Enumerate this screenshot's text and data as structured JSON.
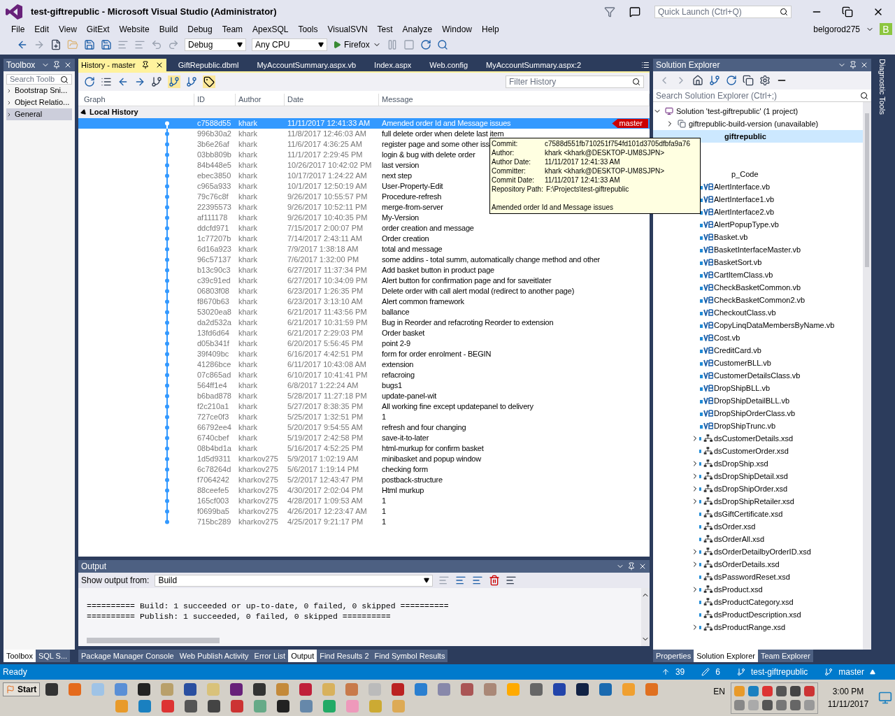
{
  "window": {
    "title": "test-giftrepublic - Microsoft Visual Studio (Administrator)",
    "quick_launch": {
      "placeholder": "Quick Launch (Ctrl+Q)"
    },
    "user": "belgorod275",
    "avatar": "B"
  },
  "menu": [
    "File",
    "Edit",
    "View",
    "GitExt",
    "Website",
    "Build",
    "Debug",
    "Team",
    "ApexSQL",
    "Tools",
    "VisualSVN",
    "Test",
    "Analyze",
    "Window",
    "Help"
  ],
  "toolbar": {
    "configuration": "Debug",
    "platform": "Any CPU",
    "run": "Firefox"
  },
  "toolbox": {
    "title": "Toolbox",
    "search": {
      "placeholder": "Search Toolb"
    },
    "items": [
      {
        "label": "Bootstrap Sni...",
        "selected": false
      },
      {
        "label": "Object Relatio...",
        "selected": false
      },
      {
        "label": "General",
        "selected": true
      }
    ],
    "tabs": [
      {
        "label": "Toolbox",
        "selected": true
      },
      {
        "label": "SQL S...",
        "selected": false
      }
    ]
  },
  "doc_tabs": [
    {
      "label": "History - master",
      "selected": true
    },
    {
      "label": "GiftRepublic.dbml",
      "selected": false
    },
    {
      "label": "MyAccountSummary.aspx.vb",
      "selected": false
    },
    {
      "label": "Index.aspx",
      "selected": false
    },
    {
      "label": "Web.config",
      "selected": false
    },
    {
      "label": "MyAccountSummary.aspx:2",
      "selected": false
    }
  ],
  "history": {
    "filter": {
      "placeholder": "Filter History"
    },
    "columns": [
      "Graph",
      "ID",
      "Author",
      "Date",
      "Message"
    ],
    "group": "Local History",
    "rows": [
      {
        "id": "c7588d55",
        "author": "khark",
        "date": "11/11/2017 12:41:33 AM",
        "message": "Amended order Id and Message issues",
        "selected": true,
        "branch": "master"
      },
      {
        "id": "996b30a2",
        "author": "khark",
        "date": "11/8/2017 12:46:03 AM",
        "message": "full delete order when delete last item",
        "selected": false
      },
      {
        "id": "3b6e26af",
        "author": "khark",
        "date": "11/6/2017 4:36:25 AM",
        "message": "register page and some other iss",
        "selected": false
      },
      {
        "id": "03bb809b",
        "author": "khark",
        "date": "11/1/2017 2:29:45 PM",
        "message": "login & bug with delete order",
        "selected": false
      },
      {
        "id": "84b448e5",
        "author": "khark",
        "date": "10/26/2017 10:42:02 PM",
        "message": "last version",
        "selected": false
      },
      {
        "id": "ebec3850",
        "author": "khark",
        "date": "10/17/2017 1:24:22 AM",
        "message": "next step",
        "selected": false
      },
      {
        "id": "c965a933",
        "author": "khark",
        "date": "10/1/2017 12:50:19 AM",
        "message": "User-Property-Edit",
        "selected": false
      },
      {
        "id": "79c76c8f",
        "author": "khark",
        "date": "9/26/2017 10:55:57 PM",
        "message": "Procedure-refresh",
        "selected": false
      },
      {
        "id": "22395573",
        "author": "khark",
        "date": "9/26/2017 10:52:11 PM",
        "message": "merge-from-server",
        "selected": false
      },
      {
        "id": "af111178",
        "author": "khark",
        "date": "9/26/2017 10:40:35 PM",
        "message": "My-Version",
        "selected": false
      },
      {
        "id": "ddcfd971",
        "author": "khark",
        "date": "7/15/2017 2:00:07 PM",
        "message": "order creation and message",
        "selected": false
      },
      {
        "id": "1c77207b",
        "author": "khark",
        "date": "7/14/2017 2:43:11 AM",
        "message": "Order creation",
        "selected": false
      },
      {
        "id": "6d16a923",
        "author": "khark",
        "date": "7/9/2017 1:38:18 AM",
        "message": "total and message",
        "selected": false
      },
      {
        "id": "96c57137",
        "author": "khark",
        "date": "7/6/2017 1:32:00 PM",
        "message": "some addins - total summ, automatically change method and other",
        "selected": false
      },
      {
        "id": "b13c90c3",
        "author": "khark",
        "date": "6/27/2017 11:37:34 PM",
        "message": "Add basket button in product page",
        "selected": false
      },
      {
        "id": "c39c91ed",
        "author": "khark",
        "date": "6/27/2017 10:34:09 PM",
        "message": "Alert button for confirmation page and for saveitlater",
        "selected": false
      },
      {
        "id": "06803f08",
        "author": "khark",
        "date": "6/23/2017 1:26:35 PM",
        "message": "Delete order with call alert modal (redirect to another page)",
        "selected": false
      },
      {
        "id": "f8670b63",
        "author": "khark",
        "date": "6/23/2017 3:13:10 AM",
        "message": "Alert common framework",
        "selected": false
      },
      {
        "id": "53020ea8",
        "author": "khark",
        "date": "6/21/2017 11:43:56 PM",
        "message": "ballance",
        "selected": false
      },
      {
        "id": "da2d532a",
        "author": "khark",
        "date": "6/21/2017 10:31:59 PM",
        "message": "Bug in Reorder and refacroting Reorder to extension",
        "selected": false
      },
      {
        "id": "13fd6d64",
        "author": "khark",
        "date": "6/21/2017 2:29:03 PM",
        "message": "Order basket",
        "selected": false
      },
      {
        "id": "d05b341f",
        "author": "khark",
        "date": "6/20/2017 5:56:45 PM",
        "message": "point 2-9",
        "selected": false
      },
      {
        "id": "39f409bc",
        "author": "khark",
        "date": "6/16/2017 4:42:51 PM",
        "message": "form for order enrolment - BEGIN",
        "selected": false
      },
      {
        "id": "41286bce",
        "author": "khark",
        "date": "6/11/2017 10:43:08 AM",
        "message": "extension",
        "selected": false
      },
      {
        "id": "07c865ad",
        "author": "khark",
        "date": "6/10/2017 10:41:41 PM",
        "message": "refacroing",
        "selected": false
      },
      {
        "id": "564ff1e4",
        "author": "khark",
        "date": "6/8/2017 1:22:24 AM",
        "message": "bugs1",
        "selected": false
      },
      {
        "id": "b6bad878",
        "author": "khark",
        "date": "5/28/2017 11:27:18 PM",
        "message": "update-panel-wit",
        "selected": false
      },
      {
        "id": "f2c210a1",
        "author": "khark",
        "date": "5/27/2017 8:38:35 PM",
        "message": "All working fine except updatepanel to delivery",
        "selected": false
      },
      {
        "id": "727ce0f3",
        "author": "khark",
        "date": "5/25/2017 1:32:51 PM",
        "message": "1",
        "selected": false
      },
      {
        "id": "66792ee4",
        "author": "khark",
        "date": "5/20/2017 9:54:55 AM",
        "message": "refresh and four changing",
        "selected": false
      },
      {
        "id": "6740cbef",
        "author": "khark",
        "date": "5/19/2017 2:42:58 PM",
        "message": "save-it-to-later",
        "selected": false
      },
      {
        "id": "08b4bd1a",
        "author": "khark",
        "date": "5/16/2017 4:52:25 PM",
        "message": "html-murkup for confirm basket",
        "selected": false
      },
      {
        "id": "1d5d9311",
        "author": "kharkov275",
        "date": "5/9/2017 1:02:19 AM",
        "message": "minibasket and popup window",
        "selected": false
      },
      {
        "id": "6c78264d",
        "author": "kharkov275",
        "date": "5/6/2017 1:19:14 PM",
        "message": "checking form",
        "selected": false
      },
      {
        "id": "f7064242",
        "author": "kharkov275",
        "date": "5/2/2017 12:43:47 PM",
        "message": "postback-structure",
        "selected": false
      },
      {
        "id": "88ceefe5",
        "author": "kharkov275",
        "date": "4/30/2017 2:02:04 PM",
        "message": "Html murkup",
        "selected": false
      },
      {
        "id": "165cf003",
        "author": "kharkov275",
        "date": "4/28/2017 1:09:53 AM",
        "message": "1",
        "selected": false
      },
      {
        "id": "f0699ba5",
        "author": "kharkov275",
        "date": "4/26/2017 12:23:47 AM",
        "message": "1",
        "selected": false
      },
      {
        "id": "715bc289",
        "author": "kharkov275",
        "date": "4/25/2017 9:21:17 PM",
        "message": "1",
        "selected": false
      }
    ]
  },
  "tooltip": {
    "fields": [
      {
        "label": "Commit:",
        "value": "c7588d551fb710251f754fd101d3705dfbfa9a76"
      },
      {
        "label": "Author:",
        "value": "khark <khark@DESKTOP-UM8SJPN>"
      },
      {
        "label": "Author Date:",
        "value": "11/11/2017 12:41:33 AM"
      },
      {
        "label": "Committer:",
        "value": "khark <khark@DESKTOP-UM8SJPN>"
      },
      {
        "label": "Commit Date:",
        "value": "11/11/2017 12:41:33 AM"
      },
      {
        "label": "Repository Path:",
        "value": "F:\\Projects\\test-giftrepublic"
      }
    ],
    "message": "Amended order Id and Message issues"
  },
  "output": {
    "title": "Output",
    "source_label": "Show output from:",
    "source": "Build",
    "lines": [
      "========== Build: 1 succeeded or up-to-date, 0 failed, 0 skipped ==========",
      "========== Publish: 1 succeeded, 0 failed, 0 skipped =========="
    ]
  },
  "bottom_tabs": [
    {
      "label": "Package Manager Console",
      "selected": false
    },
    {
      "label": "Web Publish Activity",
      "selected": false
    },
    {
      "label": "Error List",
      "selected": false
    },
    {
      "label": "Output",
      "selected": true
    },
    {
      "label": "Find Results 2",
      "selected": false
    },
    {
      "label": "Find Symbol Results",
      "selected": false
    }
  ],
  "solution_explorer": {
    "title": "Solution Explorer",
    "search": {
      "placeholder": "Search Solution Explorer (Ctrl+;)"
    },
    "tree": [
      {
        "kind": "solution",
        "label": "Solution 'test-giftrepublic' (1 project)",
        "expanded": true,
        "selected": false,
        "children": [
          {
            "kind": "project",
            "label": "giftrepublic-build-version (unavailable)",
            "expanded": false,
            "selected": false
          },
          {
            "kind": "web",
            "label": "giftrepublic",
            "expanded": true,
            "selected": true,
            "children": [
              {
                "kind": "covered",
                "selected": false
              },
              {
                "kind": "covered",
                "selected": false
              },
              {
                "kind": "folder",
                "label": "p_Code",
                "expanded": true,
                "selected": false,
                "children": [
                  {
                    "kind": "vb",
                    "label": "AlertInterface.vb",
                    "selected": false
                  },
                  {
                    "kind": "vb",
                    "label": "AlertInterface1.vb",
                    "selected": false
                  },
                  {
                    "kind": "vb",
                    "label": "AlertInterface2.vb",
                    "selected": false
                  },
                  {
                    "kind": "vb",
                    "label": "AlertPopupType.vb",
                    "selected": false
                  },
                  {
                    "kind": "vb",
                    "label": "Basket.vb",
                    "selected": false
                  },
                  {
                    "kind": "vb",
                    "label": "BasketInterfaceMaster.vb",
                    "selected": false
                  },
                  {
                    "kind": "vb",
                    "label": "BasketSort.vb",
                    "selected": false
                  },
                  {
                    "kind": "vb",
                    "label": "CartItemClass.vb",
                    "selected": false
                  },
                  {
                    "kind": "vb",
                    "label": "CheckBasketCommon.vb",
                    "selected": false
                  },
                  {
                    "kind": "vb",
                    "label": "CheckBasketCommon2.vb",
                    "selected": false
                  },
                  {
                    "kind": "vb",
                    "label": "CheckoutClass.vb",
                    "selected": false
                  },
                  {
                    "kind": "vb",
                    "label": "CopyLinqDataMembersByName.vb",
                    "selected": false
                  },
                  {
                    "kind": "vb",
                    "label": "Cost.vb",
                    "selected": false
                  },
                  {
                    "kind": "vb",
                    "label": "CreditCard.vb",
                    "selected": false
                  },
                  {
                    "kind": "vb",
                    "label": "CustomerBLL.vb",
                    "selected": false
                  },
                  {
                    "kind": "vb",
                    "label": "CustomerDetailsClass.vb",
                    "selected": false
                  },
                  {
                    "kind": "vb",
                    "label": "DropShipBLL.vb",
                    "selected": false
                  },
                  {
                    "kind": "vb",
                    "label": "DropShipDetailBLL.vb",
                    "selected": false
                  },
                  {
                    "kind": "vb",
                    "label": "DropShipOrderClass.vb",
                    "selected": false
                  },
                  {
                    "kind": "vb",
                    "label": "DropShipTrunc.vb",
                    "selected": false
                  },
                  {
                    "kind": "xsd",
                    "label": "dsCustomerDetails.xsd",
                    "expanded": false,
                    "selected": false
                  },
                  {
                    "kind": "xsd",
                    "label": "dsCustomerOrder.xsd",
                    "selected": false
                  },
                  {
                    "kind": "xsd",
                    "label": "dsDropShip.xsd",
                    "expanded": false,
                    "selected": false
                  },
                  {
                    "kind": "xsd",
                    "label": "dsDropShipDetail.xsd",
                    "expanded": false,
                    "selected": false
                  },
                  {
                    "kind": "xsd",
                    "label": "dsDropShipOrder.xsd",
                    "expanded": false,
                    "selected": false
                  },
                  {
                    "kind": "xsd",
                    "label": "dsDropShipRetailer.xsd",
                    "expanded": false,
                    "selected": false
                  },
                  {
                    "kind": "xsd",
                    "label": "dsGiftCertificate.xsd",
                    "selected": false
                  },
                  {
                    "kind": "xsd",
                    "label": "dsOrder.xsd",
                    "selected": false
                  },
                  {
                    "kind": "xsd",
                    "label": "dsOrderAll.xsd",
                    "selected": false
                  },
                  {
                    "kind": "xsd",
                    "label": "dsOrderDetailbyOrderID.xsd",
                    "expanded": false,
                    "selected": false
                  },
                  {
                    "kind": "xsd",
                    "label": "dsOrderDetails.xsd",
                    "expanded": false,
                    "selected": false
                  },
                  {
                    "kind": "xsd",
                    "label": "dsPasswordReset.xsd",
                    "selected": false
                  },
                  {
                    "kind": "xsd",
                    "label": "dsProduct.xsd",
                    "expanded": false,
                    "selected": false
                  },
                  {
                    "kind": "xsd",
                    "label": "dsProductCategory.xsd",
                    "selected": false
                  },
                  {
                    "kind": "xsd",
                    "label": "dsProductDescription.xsd",
                    "selected": false
                  },
                  {
                    "kind": "xsd",
                    "label": "dsProductRange.xsd",
                    "expanded": false,
                    "selected": false
                  }
                ]
              }
            ]
          }
        ]
      }
    ],
    "tabs": [
      {
        "label": "Properties",
        "selected": false
      },
      {
        "label": "Solution Explorer",
        "selected": true
      },
      {
        "label": "Team Explorer",
        "selected": false
      }
    ]
  },
  "side_tab": "Diagnostic Tools",
  "status_bar": {
    "text": "Ready",
    "unpushed": "39",
    "changes": "6",
    "repository": "test-giftrepublic",
    "branch": "master"
  },
  "taskbar": {
    "start": "Start",
    "language": "EN",
    "time": "3:00 PM",
    "date": "11/11/2017"
  }
}
